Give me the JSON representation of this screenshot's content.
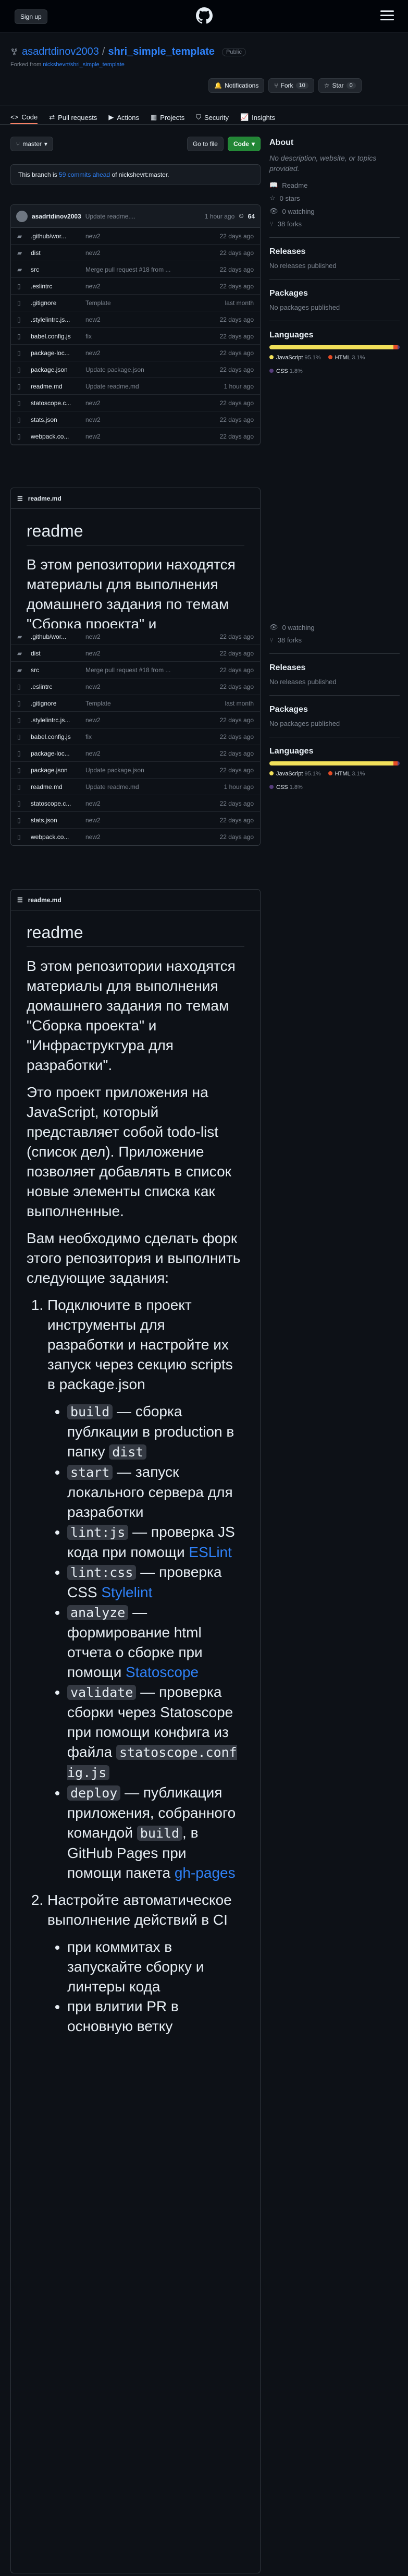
{
  "header": {
    "signup": "Sign up"
  },
  "repo": {
    "owner": "asadrtdinov2003",
    "sep": "/",
    "name": "shri_simple_template",
    "visibility": "Public",
    "forked_prefix": "Forked from",
    "forked_from": "nickshevrt/shri_simple_template",
    "notifications": "Notifications",
    "fork": "Fork",
    "fork_count": "10",
    "star": "Star",
    "star_count": "0"
  },
  "tabs": [
    "Code",
    "Pull requests",
    "Actions",
    "Projects",
    "Security",
    "Insights"
  ],
  "branch": {
    "name": "master",
    "goto": "Go to file",
    "code": "Code"
  },
  "ahead": {
    "prefix": "This branch is",
    "link": "59 commits ahead",
    "suffix": "of nickshevrt:master."
  },
  "commit": {
    "author": "asadrtdinov2003",
    "message": "Update readme....",
    "time": "1 hour ago",
    "count": "64"
  },
  "files": [
    {
      "name": ".github/wor...",
      "msg": "new2",
      "time": "22 days ago",
      "type": "dir"
    },
    {
      "name": "dist",
      "msg": "new2",
      "time": "22 days ago",
      "type": "dir"
    },
    {
      "name": "src",
      "msg": "Merge pull request #18 from ...",
      "time": "22 days ago",
      "type": "dir"
    },
    {
      "name": ".eslintrc",
      "msg": "new2",
      "time": "22 days ago",
      "type": "file"
    },
    {
      "name": ".gitignore",
      "msg": "Template",
      "time": "last month",
      "type": "file"
    },
    {
      "name": ".stylelintrc.js...",
      "msg": "new2",
      "time": "22 days ago",
      "type": "file"
    },
    {
      "name": "babel.config.js",
      "msg": "fix",
      "time": "22 days ago",
      "type": "file"
    },
    {
      "name": "package-loc...",
      "msg": "new2",
      "time": "22 days ago",
      "type": "file"
    },
    {
      "name": "package.json",
      "msg": "Update package.json",
      "time": "22 days ago",
      "type": "file"
    },
    {
      "name": "readme.md",
      "msg": "Update readme.md",
      "time": "1 hour ago",
      "type": "file"
    },
    {
      "name": "statoscope.c...",
      "msg": "new2",
      "time": "22 days ago",
      "type": "file"
    },
    {
      "name": "stats.json",
      "msg": "new2",
      "time": "22 days ago",
      "type": "file"
    },
    {
      "name": "webpack.co...",
      "msg": "new2",
      "time": "22 days ago",
      "type": "file"
    }
  ],
  "readme": {
    "file": "readme.md",
    "title": "readme",
    "p1": "В этом репозитории находятся материалы для выполнения домашнего задания по темам \"Сборка проекта\" и \"Инфраструктура для разработки\".",
    "p2": "Это проект приложения на JavaScript, который представляет собой todo-list (список дел). Приложение позволяет добавлять в список новые элементы списка как выполненные.",
    "p3": "Вам необходимо сделать форк этого репозитория и выполнить следующие задания:",
    "li1": "Подключите в проект инструменты для разработки и настройте их запуск через секцию scripts в package.json",
    "build": "build",
    "build_t": "— сборка публкации в production в папку",
    "dist": "dist",
    "start": "start",
    "start_t": "— запуск локального сервера для разработки",
    "lintjs": "lint:js",
    "lintjs_t": "— проверка JS кода при помощи",
    "eslint": "ESLint",
    "lintcss": "lint:css",
    "lintcss_t": "— проверка CSS",
    "stylelint": "Stylelint",
    "analyze": "analyze",
    "analyze_t": "— формирование html отчета о сборке при помощи",
    "statoscope": "Statoscope",
    "validate": "validate",
    "validate_t": "— проверка сборки через Statoscope при помощи конфига из файла",
    "conf": "statoscope.conf ig.js",
    "deploy": "deploy",
    "deploy_t": "— публикация приложения, собранного командой",
    "deploy_t2": ", в GitHub Pages при помощи пакета",
    "ghpages": "gh-pages",
    "li2": "Настройте автоматическое выполнение действий в CI",
    "ci1": "при коммитах в запускайте сборку и линтеры кода",
    "ci2": "при влитии PR в основную ветку"
  },
  "sidebar": {
    "about": "About",
    "desc": "No description, website, or topics provided.",
    "readme": "Readme",
    "stars": "0 stars",
    "watching": "0 watching",
    "forks": "38 forks",
    "releases": "Releases",
    "no_releases": "No releases published",
    "packages": "Packages",
    "no_packages": "No packages published",
    "languages": "Languages",
    "langs": [
      {
        "name": "JavaScript",
        "pct": "95.1%",
        "color": "#f1e05a",
        "value": 95.1
      },
      {
        "name": "HTML",
        "pct": "3.1%",
        "color": "#e34c26",
        "value": 3.1
      },
      {
        "name": "CSS",
        "pct": "1.8%",
        "color": "#563d7c",
        "value": 1.8
      }
    ]
  }
}
